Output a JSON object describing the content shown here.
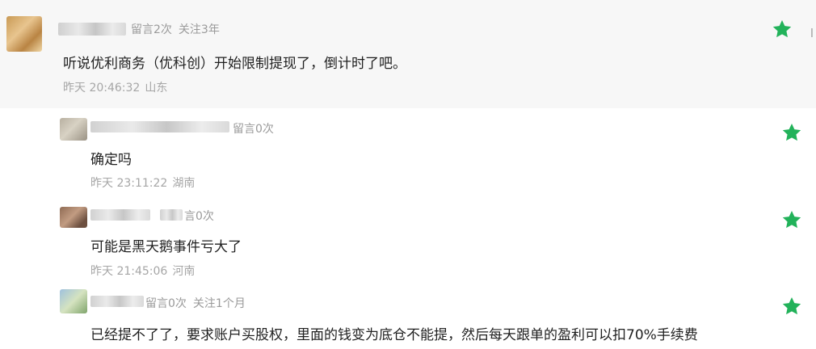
{
  "comments": [
    {
      "meta": [
        "留言2次",
        "关注3年"
      ],
      "text": "听说优利商务（优科创）开始限制提现了，倒计时了吧。",
      "time": "昨天 20:46:32",
      "location": "山东"
    },
    {
      "meta": [
        "留言0次"
      ],
      "text": "确定吗",
      "time": "昨天 23:11:22",
      "location": "湖南"
    },
    {
      "meta": [
        "言0次"
      ],
      "text": "可能是黑天鹅事件亏大了",
      "time": "昨天 21:45:06",
      "location": "河南"
    },
    {
      "meta": [
        "留言0次",
        "关注1个月"
      ],
      "text": "已经提不了了，要求账户买股权，里面的钱变为底仓不能提，然后每天跟单的盈利可以扣70%手续费",
      "time": "",
      "location": ""
    }
  ],
  "icons": {
    "star": "star-icon",
    "edge": "l"
  },
  "colors": {
    "star": "#22b25a",
    "top_bg": "#f7f7f7",
    "meta": "#9a9a9a"
  }
}
